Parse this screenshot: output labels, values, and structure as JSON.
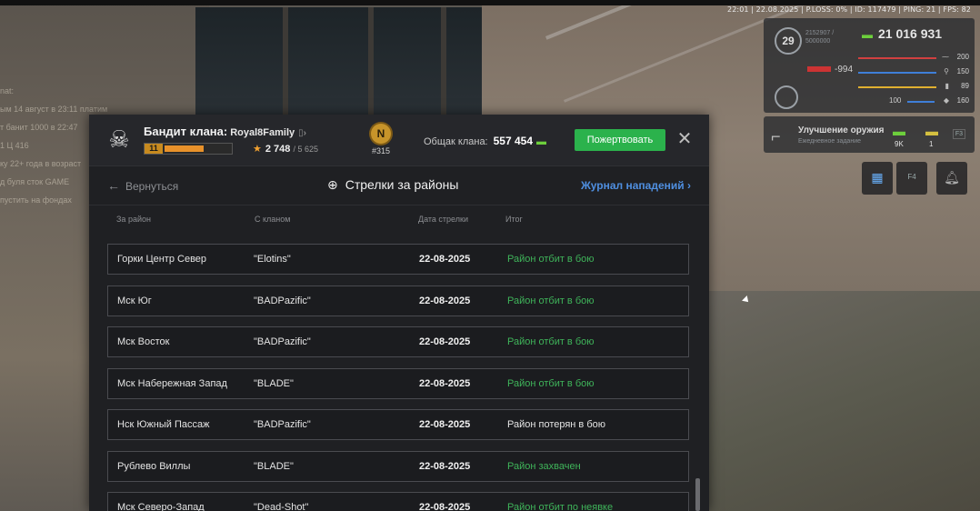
{
  "status_line": "22:01 | 22.08.2025 | P.LOSS: 0% | ID: 117479 | PING: 21 | FPS: 82",
  "chat": [
    "nat:",
    "ым 14 август в 23:11 платим",
    "",
    "т банит 1000 в 22:47",
    "1 Ц 416",
    "ку 22+ года в возраст",
    "",
    "д буля сток GAME",
    "пустить на фондах"
  ],
  "hud": {
    "level": "29",
    "exp": "2152907 / 5000000",
    "money": "21 016 931",
    "negative": "-994",
    "stats": [
      {
        "icon": "heart-rate",
        "value": "200",
        "color": "#d24040"
      },
      {
        "icon": "run",
        "value": "150",
        "color": "#3f7fd8"
      },
      {
        "icon": "ammo",
        "value": "89",
        "color": "#e0b030"
      },
      {
        "icon": "armor",
        "value": "160",
        "color": "#3f7fd8"
      }
    ],
    "armor_left": "100",
    "weapon_upgrade": {
      "title": "Улучшение оружия",
      "subtitle": "Ежедневное задание",
      "cost1": "9K",
      "cost2": "1",
      "key": "F3"
    }
  },
  "panel": {
    "rank_title": "Бандит клана:",
    "clan_name": "Royal8Family",
    "rank_num": "11",
    "rank_progress": 0.6,
    "reputation": "2 748",
    "reputation_max": "/ 5 625",
    "clan_badge_letter": "N",
    "clan_position": "#315",
    "clan_total_label": "Общак клана:",
    "clan_total_value": "557 454",
    "donate_label": "Пожертвовать",
    "back_label": "Вернуться",
    "title": "Стрелки за районы",
    "journal_label": "Журнал нападений",
    "columns": [
      "За район",
      "С кланом",
      "Дата стрелки",
      "Итог"
    ],
    "rows": [
      {
        "district": "Горки Центр Север",
        "clan": "\"Elotins\"",
        "date": "22-08-2025",
        "result": "Район отбит в бою",
        "result_color": "#3fb45a"
      },
      {
        "district": "Мск Юг",
        "clan": "\"BADPazific\"",
        "date": "22-08-2025",
        "result": "Район отбит в бою",
        "result_color": "#3fb45a"
      },
      {
        "district": "Мск Восток",
        "clan": "\"BADPazific\"",
        "date": "22-08-2025",
        "result": "Район отбит в бою",
        "result_color": "#3fb45a"
      },
      {
        "district": "Мск Набережная Запад",
        "clan": "\"BLADE\"",
        "date": "22-08-2025",
        "result": "Район отбит в бою",
        "result_color": "#3fb45a"
      },
      {
        "district": "Нск Южный Пассаж",
        "clan": "\"BADPazific\"",
        "date": "22-08-2025",
        "result": "Район потерян в бою",
        "result_color": "#e4e4e4"
      },
      {
        "district": "Рублево Виллы",
        "clan": "\"BLADE\"",
        "date": "22-08-2025",
        "result": "Район захвачен",
        "result_color": "#3fb45a"
      },
      {
        "district": "Мск Северо-Запад",
        "clan": "\"Dead-Shot\"",
        "date": "22-08-2025",
        "result": "Район отбит по неявке",
        "result_color": "#3fb45a"
      }
    ]
  },
  "colors": {
    "accent_green": "#2bb24c",
    "link_blue": "#4f8fe0",
    "rank_orange": "#e8912a"
  }
}
